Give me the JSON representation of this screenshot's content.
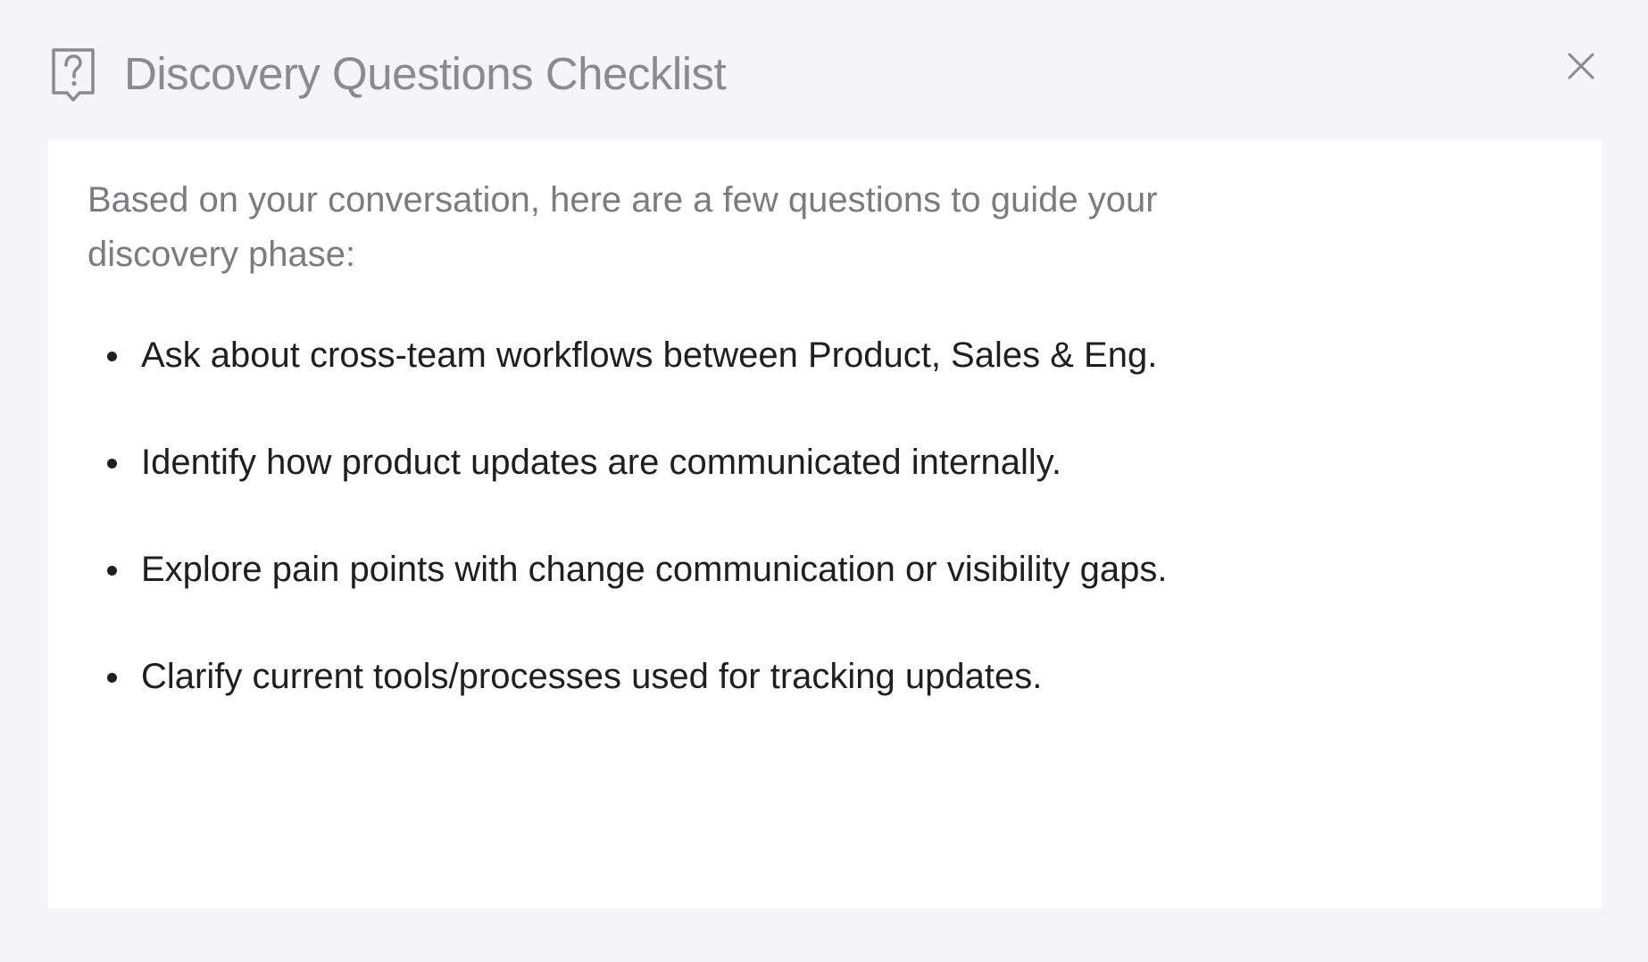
{
  "dialog": {
    "title": "Discovery Questions Checklist",
    "title_icon": "question-bubble-icon",
    "close_icon": "close-icon",
    "intro": "Based on your conversation, here are a few questions to guide your discovery phase:",
    "questions": [
      "Ask about cross-team workflows between Product, Sales & Eng.",
      "Identify how product updates are communicated internally.",
      "Explore pain points with change communication or visibility gaps.",
      "Clarify current tools/processes used for tracking updates."
    ]
  },
  "colors": {
    "background": "#f5f4f7",
    "panel": "#ffffff",
    "title_text": "#8a8a8f",
    "intro_text": "#7b7b80",
    "body_text": "#1f1f22"
  }
}
